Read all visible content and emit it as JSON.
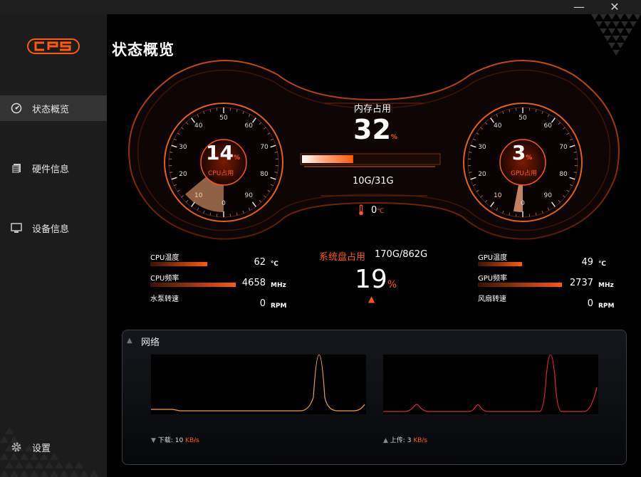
{
  "window": {
    "minimize_icon": "minimize-icon",
    "close_icon": "close-icon"
  },
  "logo": {
    "text": "CPS"
  },
  "sidebar": {
    "items": [
      {
        "label": "状态概览",
        "icon": "speedometer-icon",
        "active": true
      },
      {
        "label": "硬件信息",
        "icon": "document-icon",
        "active": false
      },
      {
        "label": "设备信息",
        "icon": "monitor-icon",
        "active": false
      }
    ],
    "settings": {
      "label": "设置",
      "icon": "gear-icon"
    }
  },
  "page": {
    "title": "状态概览"
  },
  "gauge_ticks": [
    "0",
    "10",
    "20",
    "30",
    "40",
    "50",
    "60",
    "70",
    "80",
    "90"
  ],
  "cpu": {
    "usage": "14",
    "usage_unit": "%",
    "usage_label": "CPU占用",
    "usage_fraction": 0.14
  },
  "gpu": {
    "usage": "3",
    "usage_unit": "%",
    "usage_label": "GPU占用",
    "usage_fraction": 0.03
  },
  "memory": {
    "label": "内存占用",
    "value": "32",
    "unit": "%",
    "fraction": 0.32,
    "detail": "10G/31G"
  },
  "temperature": {
    "value": "0",
    "unit": "℃",
    "icon": "thermometer-icon"
  },
  "cpu_stats": [
    {
      "label": "CPU温度",
      "value": "62",
      "unit": "℃"
    },
    {
      "label": "CPU频率",
      "value": "4658",
      "unit": "MHz"
    },
    {
      "label": "水泵转速",
      "value": "0",
      "unit": "RPM"
    }
  ],
  "gpu_stats": [
    {
      "label": "GPU温度",
      "value": "49",
      "unit": "℃"
    },
    {
      "label": "GPU频率",
      "value": "2737",
      "unit": "MHz"
    },
    {
      "label": "风扇转速",
      "value": "0",
      "unit": "RPM"
    }
  ],
  "disk": {
    "label": "系统盘占用",
    "detail": "170G/862G",
    "value": "19",
    "unit": "%"
  },
  "network": {
    "title": "网络",
    "download": {
      "label": "下载:",
      "value": "10",
      "unit": "KB/s",
      "color": "#f0a040"
    },
    "upload": {
      "label": "上传:",
      "value": "3",
      "unit": "KB/s",
      "color": "#e0243c"
    }
  },
  "colors": {
    "accent": "#ff5a0a",
    "sidebar_bg": "#1c1c1c",
    "active_nav_bg": "#333333"
  }
}
